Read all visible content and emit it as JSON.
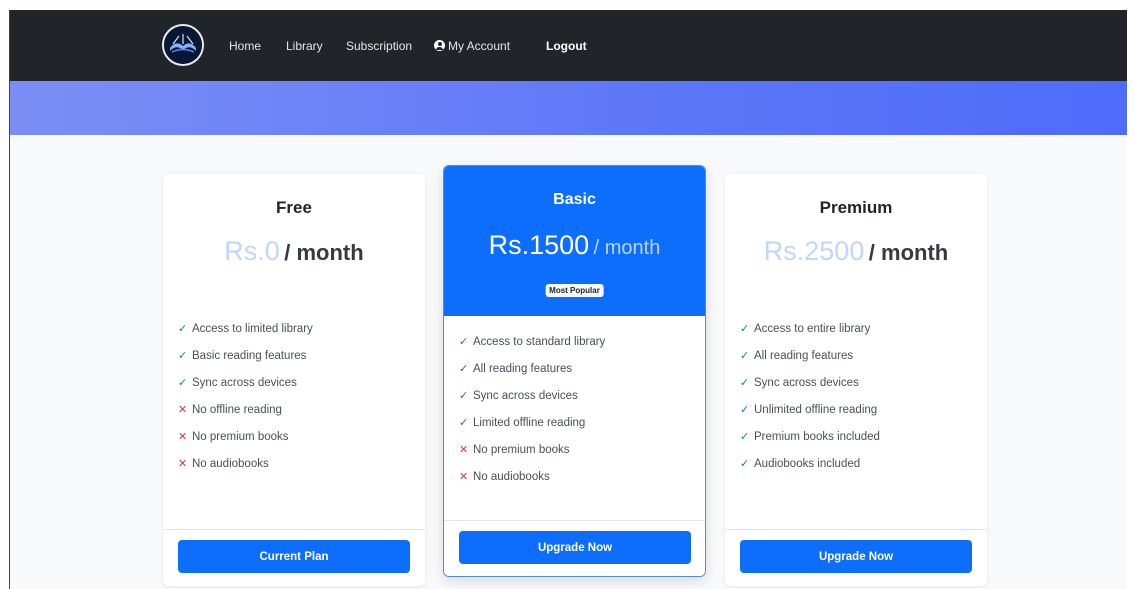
{
  "nav": {
    "links": [
      {
        "label": "Home"
      },
      {
        "label": "Library"
      },
      {
        "label": "Subscription"
      },
      {
        "label": "My Account"
      },
      {
        "label": "Logout"
      }
    ]
  },
  "plans": [
    {
      "name": "Free",
      "amount": "Rs.0",
      "period": "/ month",
      "features": [
        {
          "text": "Access to limited library",
          "included": true
        },
        {
          "text": "Basic reading features",
          "included": true
        },
        {
          "text": "Sync across devices",
          "included": true
        },
        {
          "text": "No offline reading",
          "included": false
        },
        {
          "text": "No premium books",
          "included": false
        },
        {
          "text": "No audiobooks",
          "included": false
        }
      ],
      "button": "Current Plan"
    },
    {
      "name": "Basic",
      "amount": "Rs.1500",
      "period": "/ month",
      "badge": "Most Popular",
      "features": [
        {
          "text": "Access to standard library",
          "included": true
        },
        {
          "text": "All reading features",
          "included": true
        },
        {
          "text": "Sync across devices",
          "included": true
        },
        {
          "text": "Limited offline reading",
          "included": true
        },
        {
          "text": "No premium books",
          "included": false
        },
        {
          "text": "No audiobooks",
          "included": false
        }
      ],
      "button": "Upgrade Now"
    },
    {
      "name": "Premium",
      "amount": "Rs.2500",
      "period": "/ month",
      "features": [
        {
          "text": "Access to entire library",
          "included": true
        },
        {
          "text": "All reading features",
          "included": true
        },
        {
          "text": "Sync across devices",
          "included": true
        },
        {
          "text": "Unlimited offline reading",
          "included": true
        },
        {
          "text": "Premium books included",
          "included": true
        },
        {
          "text": "Audiobooks included",
          "included": true
        }
      ],
      "button": "Upgrade Now"
    }
  ],
  "marks": {
    "yes": "✓",
    "no": "✕"
  },
  "colors": {
    "navbar": "#212529",
    "hero_start": "#7c8ef6",
    "hero_end": "#4d6cfa",
    "primary": "#0d6efd",
    "check": "#198754",
    "cross": "#dc3545"
  }
}
